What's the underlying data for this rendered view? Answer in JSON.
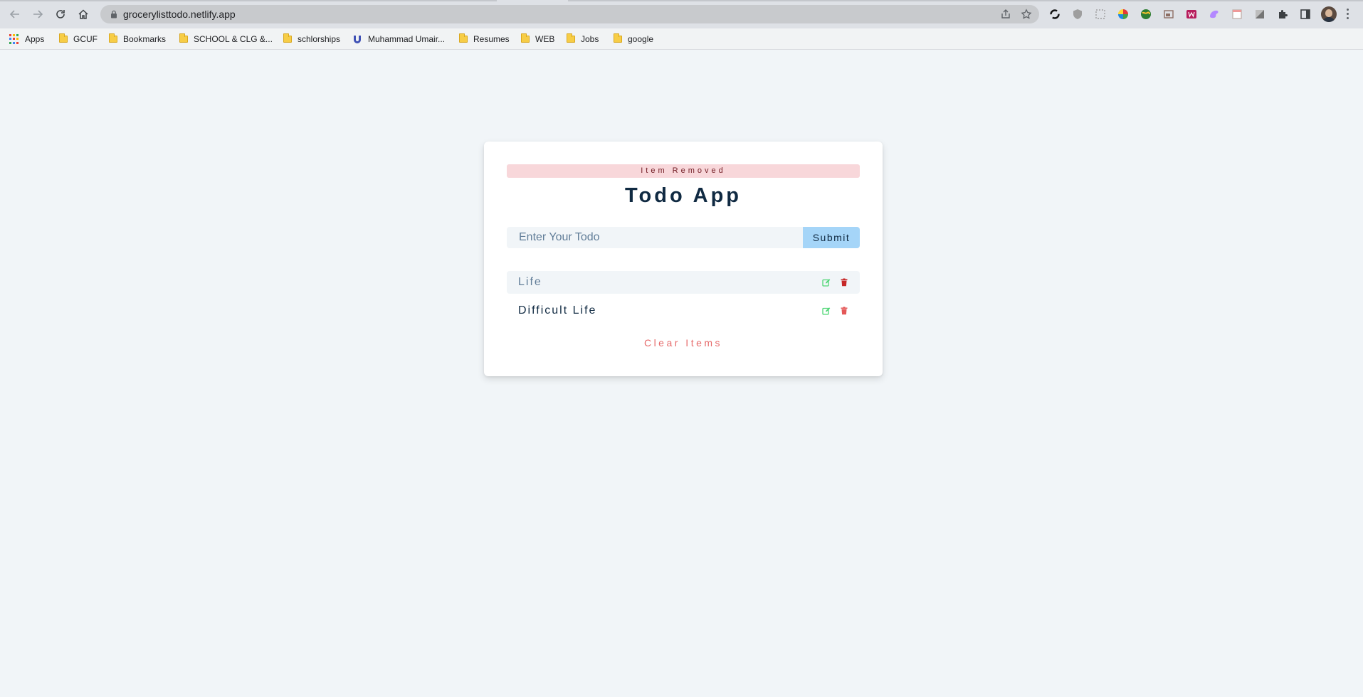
{
  "browser": {
    "url": "grocerylisttodo.netlify.app",
    "bookmarks": [
      {
        "label": "Apps",
        "icon": "apps-grid-icon"
      },
      {
        "label": "GCUF",
        "icon": "folder-icon"
      },
      {
        "label": "Bookmarks",
        "icon": "folder-icon"
      },
      {
        "label": "SCHOOL & CLG &...",
        "icon": "folder-icon"
      },
      {
        "label": "schlorships",
        "icon": "folder-icon"
      },
      {
        "label": "Muhammad Umair...",
        "icon": "site-favicon-icon"
      },
      {
        "label": "Resumes",
        "icon": "folder-icon"
      },
      {
        "label": "WEB",
        "icon": "folder-icon"
      },
      {
        "label": "Jobs",
        "icon": "folder-icon"
      },
      {
        "label": "google",
        "icon": "folder-icon"
      }
    ]
  },
  "app": {
    "alert": "Item Removed",
    "title": "Todo App",
    "input_placeholder": "Enter Your Todo",
    "submit_label": "Submit",
    "items": [
      {
        "title": "Life"
      },
      {
        "title": "Difficult Life"
      }
    ],
    "clear_label": "Clear Items"
  },
  "colors": {
    "page_bg": "#f1f5f8",
    "alert_bg": "#f8d7da",
    "title": "#102a42",
    "submit_bg": "#a5d5f8",
    "edit_icon": "#4fd675",
    "delete_icon": "#c62828",
    "clear_text": "#e66b6b"
  }
}
